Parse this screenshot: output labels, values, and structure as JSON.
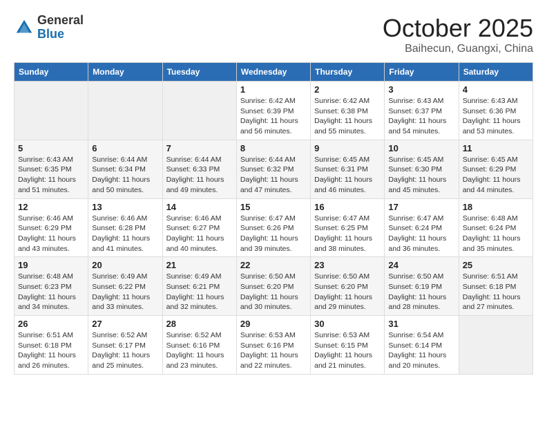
{
  "header": {
    "logo_line1": "General",
    "logo_line2": "Blue",
    "month": "October 2025",
    "location": "Baihecun, Guangxi, China"
  },
  "weekdays": [
    "Sunday",
    "Monday",
    "Tuesday",
    "Wednesday",
    "Thursday",
    "Friday",
    "Saturday"
  ],
  "weeks": [
    [
      {
        "day": "",
        "info": ""
      },
      {
        "day": "",
        "info": ""
      },
      {
        "day": "",
        "info": ""
      },
      {
        "day": "1",
        "info": "Sunrise: 6:42 AM\nSunset: 6:39 PM\nDaylight: 11 hours and 56 minutes."
      },
      {
        "day": "2",
        "info": "Sunrise: 6:42 AM\nSunset: 6:38 PM\nDaylight: 11 hours and 55 minutes."
      },
      {
        "day": "3",
        "info": "Sunrise: 6:43 AM\nSunset: 6:37 PM\nDaylight: 11 hours and 54 minutes."
      },
      {
        "day": "4",
        "info": "Sunrise: 6:43 AM\nSunset: 6:36 PM\nDaylight: 11 hours and 53 minutes."
      }
    ],
    [
      {
        "day": "5",
        "info": "Sunrise: 6:43 AM\nSunset: 6:35 PM\nDaylight: 11 hours and 51 minutes."
      },
      {
        "day": "6",
        "info": "Sunrise: 6:44 AM\nSunset: 6:34 PM\nDaylight: 11 hours and 50 minutes."
      },
      {
        "day": "7",
        "info": "Sunrise: 6:44 AM\nSunset: 6:33 PM\nDaylight: 11 hours and 49 minutes."
      },
      {
        "day": "8",
        "info": "Sunrise: 6:44 AM\nSunset: 6:32 PM\nDaylight: 11 hours and 47 minutes."
      },
      {
        "day": "9",
        "info": "Sunrise: 6:45 AM\nSunset: 6:31 PM\nDaylight: 11 hours and 46 minutes."
      },
      {
        "day": "10",
        "info": "Sunrise: 6:45 AM\nSunset: 6:30 PM\nDaylight: 11 hours and 45 minutes."
      },
      {
        "day": "11",
        "info": "Sunrise: 6:45 AM\nSunset: 6:29 PM\nDaylight: 11 hours and 44 minutes."
      }
    ],
    [
      {
        "day": "12",
        "info": "Sunrise: 6:46 AM\nSunset: 6:29 PM\nDaylight: 11 hours and 43 minutes."
      },
      {
        "day": "13",
        "info": "Sunrise: 6:46 AM\nSunset: 6:28 PM\nDaylight: 11 hours and 41 minutes."
      },
      {
        "day": "14",
        "info": "Sunrise: 6:46 AM\nSunset: 6:27 PM\nDaylight: 11 hours and 40 minutes."
      },
      {
        "day": "15",
        "info": "Sunrise: 6:47 AM\nSunset: 6:26 PM\nDaylight: 11 hours and 39 minutes."
      },
      {
        "day": "16",
        "info": "Sunrise: 6:47 AM\nSunset: 6:25 PM\nDaylight: 11 hours and 38 minutes."
      },
      {
        "day": "17",
        "info": "Sunrise: 6:47 AM\nSunset: 6:24 PM\nDaylight: 11 hours and 36 minutes."
      },
      {
        "day": "18",
        "info": "Sunrise: 6:48 AM\nSunset: 6:24 PM\nDaylight: 11 hours and 35 minutes."
      }
    ],
    [
      {
        "day": "19",
        "info": "Sunrise: 6:48 AM\nSunset: 6:23 PM\nDaylight: 11 hours and 34 minutes."
      },
      {
        "day": "20",
        "info": "Sunrise: 6:49 AM\nSunset: 6:22 PM\nDaylight: 11 hours and 33 minutes."
      },
      {
        "day": "21",
        "info": "Sunrise: 6:49 AM\nSunset: 6:21 PM\nDaylight: 11 hours and 32 minutes."
      },
      {
        "day": "22",
        "info": "Sunrise: 6:50 AM\nSunset: 6:20 PM\nDaylight: 11 hours and 30 minutes."
      },
      {
        "day": "23",
        "info": "Sunrise: 6:50 AM\nSunset: 6:20 PM\nDaylight: 11 hours and 29 minutes."
      },
      {
        "day": "24",
        "info": "Sunrise: 6:50 AM\nSunset: 6:19 PM\nDaylight: 11 hours and 28 minutes."
      },
      {
        "day": "25",
        "info": "Sunrise: 6:51 AM\nSunset: 6:18 PM\nDaylight: 11 hours and 27 minutes."
      }
    ],
    [
      {
        "day": "26",
        "info": "Sunrise: 6:51 AM\nSunset: 6:18 PM\nDaylight: 11 hours and 26 minutes."
      },
      {
        "day": "27",
        "info": "Sunrise: 6:52 AM\nSunset: 6:17 PM\nDaylight: 11 hours and 25 minutes."
      },
      {
        "day": "28",
        "info": "Sunrise: 6:52 AM\nSunset: 6:16 PM\nDaylight: 11 hours and 23 minutes."
      },
      {
        "day": "29",
        "info": "Sunrise: 6:53 AM\nSunset: 6:16 PM\nDaylight: 11 hours and 22 minutes."
      },
      {
        "day": "30",
        "info": "Sunrise: 6:53 AM\nSunset: 6:15 PM\nDaylight: 11 hours and 21 minutes."
      },
      {
        "day": "31",
        "info": "Sunrise: 6:54 AM\nSunset: 6:14 PM\nDaylight: 11 hours and 20 minutes."
      },
      {
        "day": "",
        "info": ""
      }
    ]
  ]
}
